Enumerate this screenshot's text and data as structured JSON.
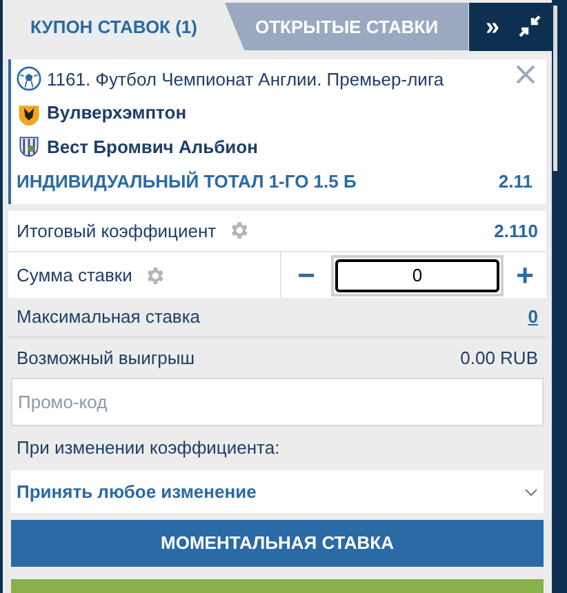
{
  "tabs": [
    {
      "label": "КУПОН СТАВОК (1)",
      "selected": true
    },
    {
      "label": "ОТКРЫТЫЕ СТАВКИ",
      "selected": false
    }
  ],
  "tab_controls": {
    "more": "»"
  },
  "bet": {
    "event": "1161. Футбол Чемпионат Англии. Премьер-лига",
    "home": "Вулверхэмптон",
    "away": "Вест Бромвич Альбион",
    "market": "ИНДИВИДУАЛЬНЫЙ ТОТАЛ 1-ГО 1.5 Б",
    "odds": "2.11"
  },
  "total_odds": {
    "label": "Итоговый коэффициент",
    "value": "2.110"
  },
  "stake": {
    "label": "Сумма ставки",
    "minus": "−",
    "value": "0",
    "plus": "+"
  },
  "max_stake": {
    "label": "Максимальная ставка",
    "value": "0"
  },
  "possible_win": {
    "label": "Возможный выигрыш",
    "value": "0.00 RUB"
  },
  "promo": {
    "placeholder": "Промо-код"
  },
  "odds_change": {
    "label": "При изменении коэффициента:",
    "value": "Принять любое изменение"
  },
  "submit": "МОМЕНТАЛЬНАЯ СТАВКА"
}
